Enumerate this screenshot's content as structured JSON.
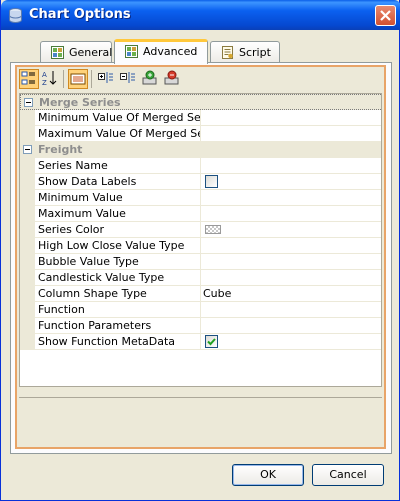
{
  "window": {
    "title": "Chart Options",
    "title_icon": "chart-options-icon",
    "close_icon": "close-icon"
  },
  "tabs": [
    {
      "label": "General",
      "icon": "general-tab-icon",
      "active": false
    },
    {
      "label": "Advanced",
      "icon": "advanced-tab-icon",
      "active": true
    },
    {
      "label": "Script",
      "icon": "script-tab-icon",
      "active": false
    }
  ],
  "toolbar": {
    "items": [
      {
        "name": "categorized-button",
        "icon": "categorized-icon",
        "pressed": true
      },
      {
        "name": "alphabetical-button",
        "icon": "sort-alphabetical-icon",
        "pressed": false
      },
      {
        "name": "property-pages-button",
        "icon": "property-pages-icon",
        "pressed": true
      },
      {
        "name": "expand-all-button",
        "icon": "expand-all-icon",
        "pressed": false
      },
      {
        "name": "collapse-all-button",
        "icon": "collapse-all-icon",
        "pressed": false
      },
      {
        "name": "add-button",
        "icon": "add-item-icon",
        "pressed": false
      },
      {
        "name": "remove-button",
        "icon": "remove-item-icon",
        "pressed": false
      }
    ]
  },
  "properties": {
    "merge_series": {
      "title": "Merge Series",
      "rows": [
        {
          "name": "Minimum Value Of Merged Series",
          "value": ""
        },
        {
          "name": "Maximum Value Of Merged Series",
          "value": ""
        }
      ]
    },
    "freight": {
      "title": "Freight",
      "rows": [
        {
          "name": "Series Name",
          "value": ""
        },
        {
          "name": "Show Data Labels",
          "value": "",
          "type": "checkbox",
          "checked": false
        },
        {
          "name": "Minimum Value",
          "value": ""
        },
        {
          "name": "Maximum Value",
          "value": ""
        },
        {
          "name": "Series Color",
          "value": "",
          "type": "color"
        },
        {
          "name": "High Low Close Value Type",
          "value": ""
        },
        {
          "name": "Bubble Value Type",
          "value": ""
        },
        {
          "name": "Candlestick Value Type",
          "value": ""
        },
        {
          "name": "Column Shape Type",
          "value": "Cube"
        },
        {
          "name": "Function",
          "value": ""
        },
        {
          "name": "Function Parameters",
          "value": ""
        },
        {
          "name": "Show Function MetaData",
          "value": "",
          "type": "checkbox",
          "checked": true
        }
      ]
    }
  },
  "buttons": {
    "ok": "OK",
    "cancel": "Cancel"
  },
  "colors": {
    "title_blue": "#0548d0",
    "tab_highlight": "#ffc83c",
    "panel_border": "#e8a468",
    "check_green": "#21a121"
  }
}
